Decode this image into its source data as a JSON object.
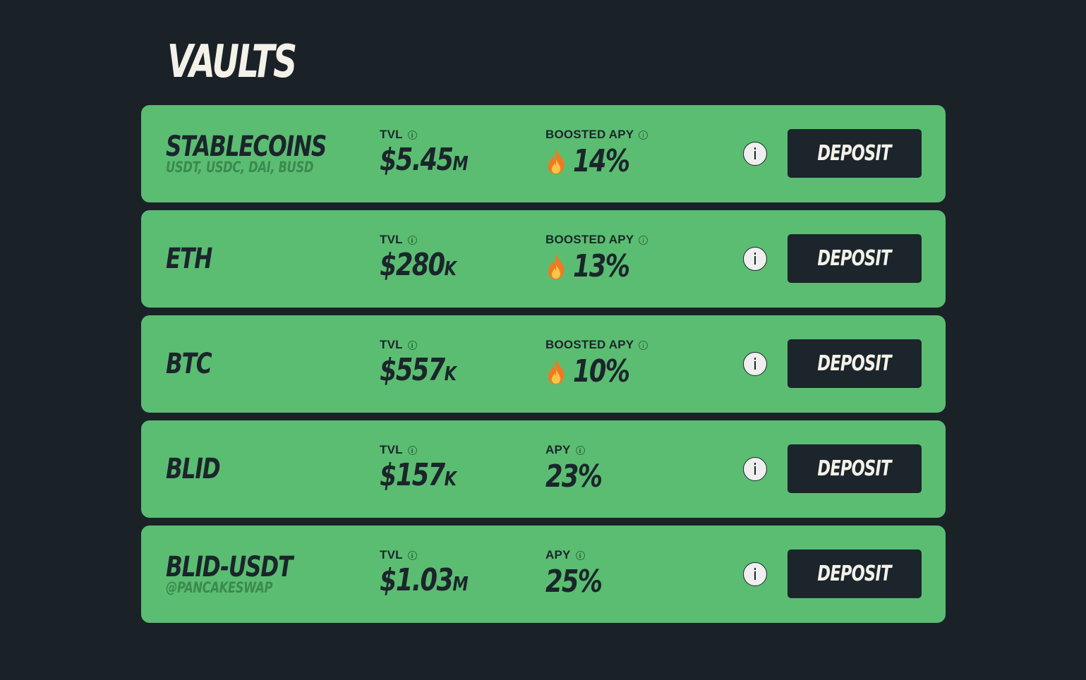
{
  "page": {
    "title": "VAULTS"
  },
  "colors": {
    "background": "#1a2228",
    "card": "#5bbd72",
    "button": "#1b252b",
    "button_text": "#f4f1e9",
    "subtitle": "#3b8a4e"
  },
  "vaults": [
    {
      "name": "STABLECOINS",
      "subtitle": "USDT, USDC, DAI, BUSD",
      "tvl_label": "TVL",
      "tvl_value": "$5.45",
      "tvl_unit": "M",
      "apy_label": "BOOSTED APY",
      "apy_value": "14%",
      "boosted": true,
      "info_icon": "info-circle-icon",
      "deposit_label": "DEPOSIT"
    },
    {
      "name": "ETH",
      "tvl_label": "TVL",
      "tvl_value": "$280",
      "tvl_unit": "K",
      "apy_label": "BOOSTED APY",
      "apy_value": "13%",
      "boosted": true,
      "info_icon": "info-circle-icon",
      "deposit_label": "DEPOSIT"
    },
    {
      "name": "BTC",
      "tvl_label": "TVL",
      "tvl_value": "$557",
      "tvl_unit": "K",
      "apy_label": "BOOSTED APY",
      "apy_value": "10%",
      "boosted": true,
      "info_icon": "info-circle-icon",
      "deposit_label": "DEPOSIT"
    },
    {
      "name": "BLID",
      "tvl_label": "TVL",
      "tvl_value": "$157",
      "tvl_unit": "K",
      "apy_label": "APY",
      "apy_value": "23%",
      "boosted": false,
      "info_icon": "info-circle-icon",
      "deposit_label": "DEPOSIT"
    },
    {
      "name": "BLID-USDT",
      "subtitle": "@PANCAKESWAP",
      "tvl_label": "TVL",
      "tvl_value": "$1.03",
      "tvl_unit": "M",
      "apy_label": "APY",
      "apy_value": "25%",
      "boosted": false,
      "info_icon": "info-circle-icon",
      "deposit_label": "DEPOSIT"
    }
  ]
}
